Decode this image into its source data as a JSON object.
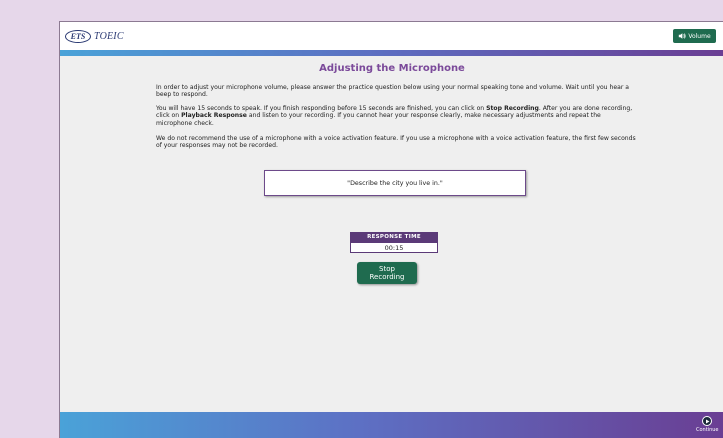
{
  "header": {
    "logo_ets": "ETS",
    "logo_toeic": "TOEIC",
    "volume_label": "Volume",
    "volume_icon": "speaker-icon"
  },
  "main": {
    "title": "Adjusting the Microphone",
    "para1": "In order to adjust your microphone volume, please answer the practice question below using your normal speaking tone and volume. Wait until you hear a beep to respond.",
    "para2_a": "You will have 15 seconds to speak. If you finish responding before 15 seconds are finished, you can click on ",
    "para2_b": "Stop Recording",
    "para2_c": ". After you are done recording, click on ",
    "para2_d": "Playback Response",
    "para2_e": " and listen to your recording. If you cannot hear your response clearly, make necessary adjustments and repeat the microphone check.",
    "para3": "We do not recommend the use of a microphone with a voice activation feature. If you use a microphone with a voice activation feature, the first few seconds of your responses may not be recorded.",
    "question": "\"Describe the city you live in.\"",
    "response_time_label": "RESPONSE TIME",
    "response_time_value": "00:15",
    "stop_button_label": "Stop\nRecording"
  },
  "footer": {
    "continue_label": "Continue",
    "continue_icon": "play-circle-icon"
  },
  "colors": {
    "accent_green": "#1f6b4f",
    "title_purple": "#7b4a9a",
    "panel_purple": "#5b3a78",
    "outer_background": "#e6d7ea"
  }
}
